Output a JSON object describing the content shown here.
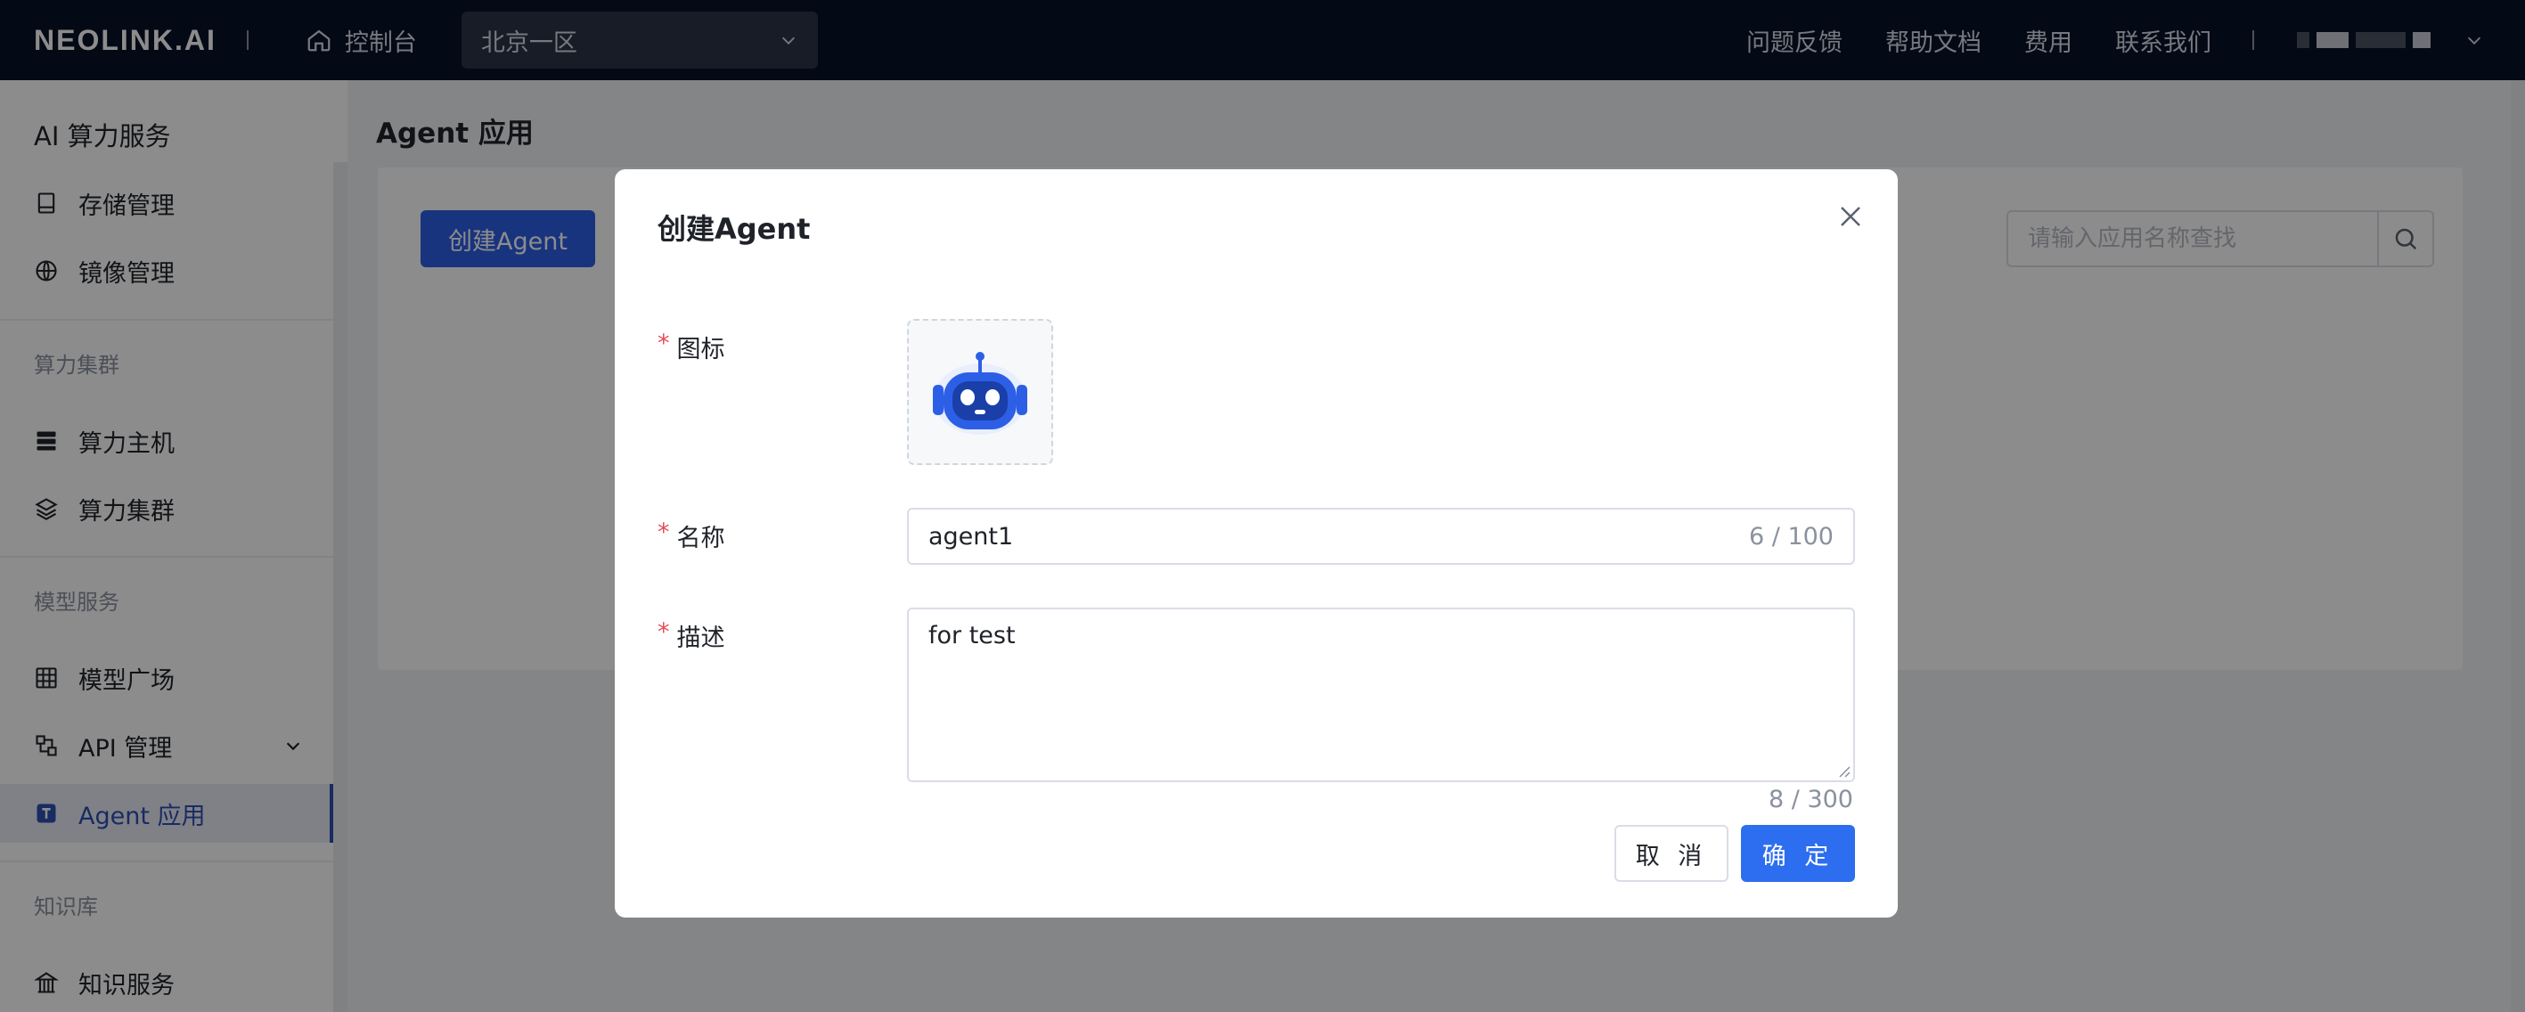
{
  "header": {
    "logo": "NEOLINK.AI",
    "home_label": "控制台",
    "region": "北京一区",
    "links": [
      "问题反馈",
      "帮助文档",
      "费用",
      "联系我们"
    ]
  },
  "sidebar": {
    "title": "AI 算力服务",
    "items": [
      {
        "label": "存储管理"
      },
      {
        "label": "镜像管理"
      },
      {
        "label": "算力主机"
      },
      {
        "label": "算力集群"
      },
      {
        "label": "模型广场"
      },
      {
        "label": "API 管理"
      },
      {
        "label": "Agent 应用"
      },
      {
        "label": "知识服务"
      }
    ],
    "groups": [
      "算力集群",
      "模型服务",
      "知识库"
    ]
  },
  "main": {
    "title": "Agent 应用",
    "create_label": "创建Agent",
    "search_placeholder": "请输入应用名称查找"
  },
  "modal": {
    "title": "创建Agent",
    "icon_label": "图标",
    "name_label": "名称",
    "name_value": "agent1",
    "name_count": "6 / 100",
    "desc_label": "描述",
    "desc_value": "for test",
    "desc_count": "8 / 300",
    "cancel_label": "取 消",
    "ok_label": "确 定"
  },
  "colors": {
    "primary": "#2d6ef0",
    "nav_bg": "#061127",
    "required": "#e34d59"
  }
}
